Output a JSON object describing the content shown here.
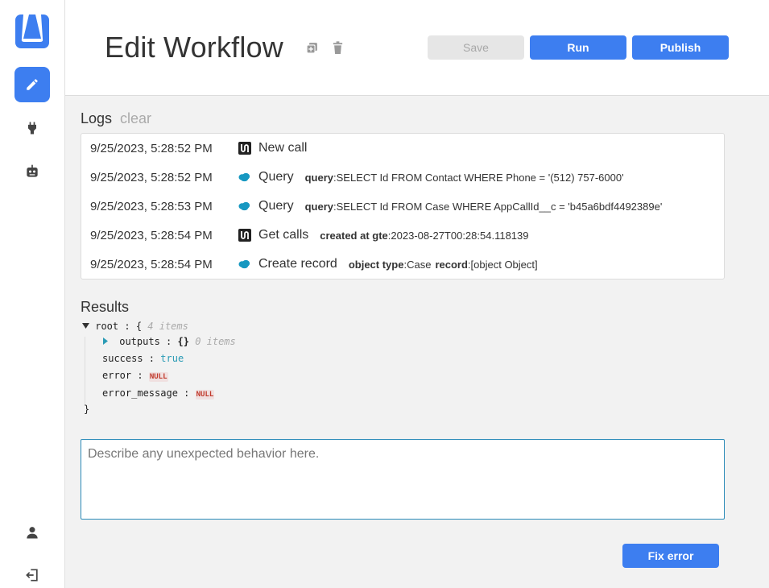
{
  "header": {
    "title": "Edit Workflow",
    "save_label": "Save",
    "run_label": "Run",
    "publish_label": "Publish"
  },
  "sidebar": {
    "items": [
      {
        "name": "edit",
        "icon": "pencil-icon",
        "active": true
      },
      {
        "name": "integrations",
        "icon": "plug-icon",
        "active": false
      },
      {
        "name": "bots",
        "icon": "robot-icon",
        "active": false
      },
      {
        "name": "account",
        "icon": "user-icon",
        "active": false
      },
      {
        "name": "logout",
        "icon": "logout-icon",
        "active": false
      }
    ]
  },
  "logs": {
    "title": "Logs",
    "clear_label": "clear",
    "entries": [
      {
        "time": "9/25/2023, 5:28:52 PM",
        "icon": "ringcentral-icon",
        "type": "New call",
        "params": []
      },
      {
        "time": "9/25/2023, 5:28:52 PM",
        "icon": "salesforce-icon",
        "type": "Query",
        "params": [
          {
            "key": "query",
            "value": "SELECT Id FROM Contact WHERE Phone = '(512) 757-6000'"
          }
        ]
      },
      {
        "time": "9/25/2023, 5:28:53 PM",
        "icon": "salesforce-icon",
        "type": "Query",
        "params": [
          {
            "key": "query",
            "value": "SELECT Id FROM Case WHERE AppCallId__c = 'b45a6bdf4492389e'"
          }
        ]
      },
      {
        "time": "9/25/2023, 5:28:54 PM",
        "icon": "ringcentral-icon",
        "type": "Get calls",
        "params": [
          {
            "key": "created at gte",
            "value": "2023-08-27T00:28:54.118139"
          }
        ]
      },
      {
        "time": "9/25/2023, 5:28:54 PM",
        "icon": "salesforce-icon",
        "type": "Create record",
        "params": [
          {
            "key": "object type",
            "value": "Case"
          },
          {
            "key": "record",
            "value": "[object Object]"
          }
        ]
      }
    ]
  },
  "results": {
    "title": "Results",
    "root_key": "root",
    "root_count": "4 items",
    "outputs_key": "outputs",
    "outputs_value": "{}",
    "outputs_count": "0 items",
    "success_key": "success",
    "success_value": "true",
    "error_key": "error",
    "error_value": "NULL",
    "error_message_key": "error_message",
    "error_message_value": "NULL"
  },
  "feedback": {
    "placeholder": "Describe any unexpected behavior here.",
    "value": ""
  },
  "fix_error_label": "Fix error",
  "colors": {
    "accent": "#3d7ef0",
    "salesforce": "#1798c1",
    "textarea_border": "#2a8ab8"
  }
}
